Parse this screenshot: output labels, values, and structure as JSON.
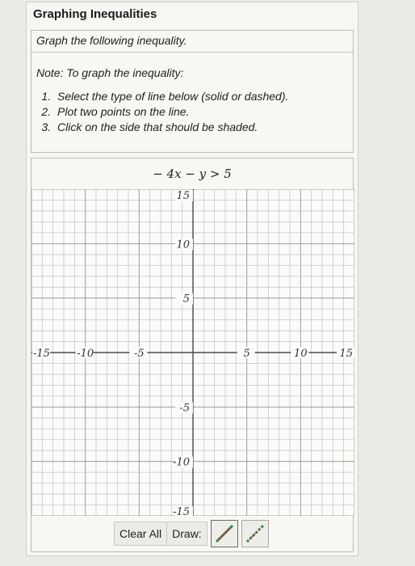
{
  "title": "Graphing Inequalities",
  "instruction": "Graph the following inequality.",
  "note": "Note: To graph the inequality:",
  "steps": [
    "Select the type of line below (solid or dashed).",
    "Plot two points on the line.",
    "Click on the side that should be shaded."
  ],
  "equation": "− 4x − y > 5",
  "graph": {
    "x_range": [
      -15,
      15
    ],
    "y_range": [
      -15,
      15
    ],
    "x_tick_labels": [
      "-15",
      "-10",
      "-5",
      "5",
      "10",
      "15"
    ],
    "y_tick_labels": [
      "15",
      "10",
      "5",
      "-5",
      "-10",
      "-15"
    ],
    "major_step": 5,
    "minor_step": 1
  },
  "controls": {
    "clear_label": "Clear All",
    "draw_label": "Draw:",
    "tools": [
      {
        "name": "solid-line-tool",
        "style": "solid"
      },
      {
        "name": "dashed-line-tool",
        "style": "dashed"
      }
    ]
  },
  "colors": {
    "line_green": "#2e8b4a",
    "line_red": "#c0392b"
  }
}
